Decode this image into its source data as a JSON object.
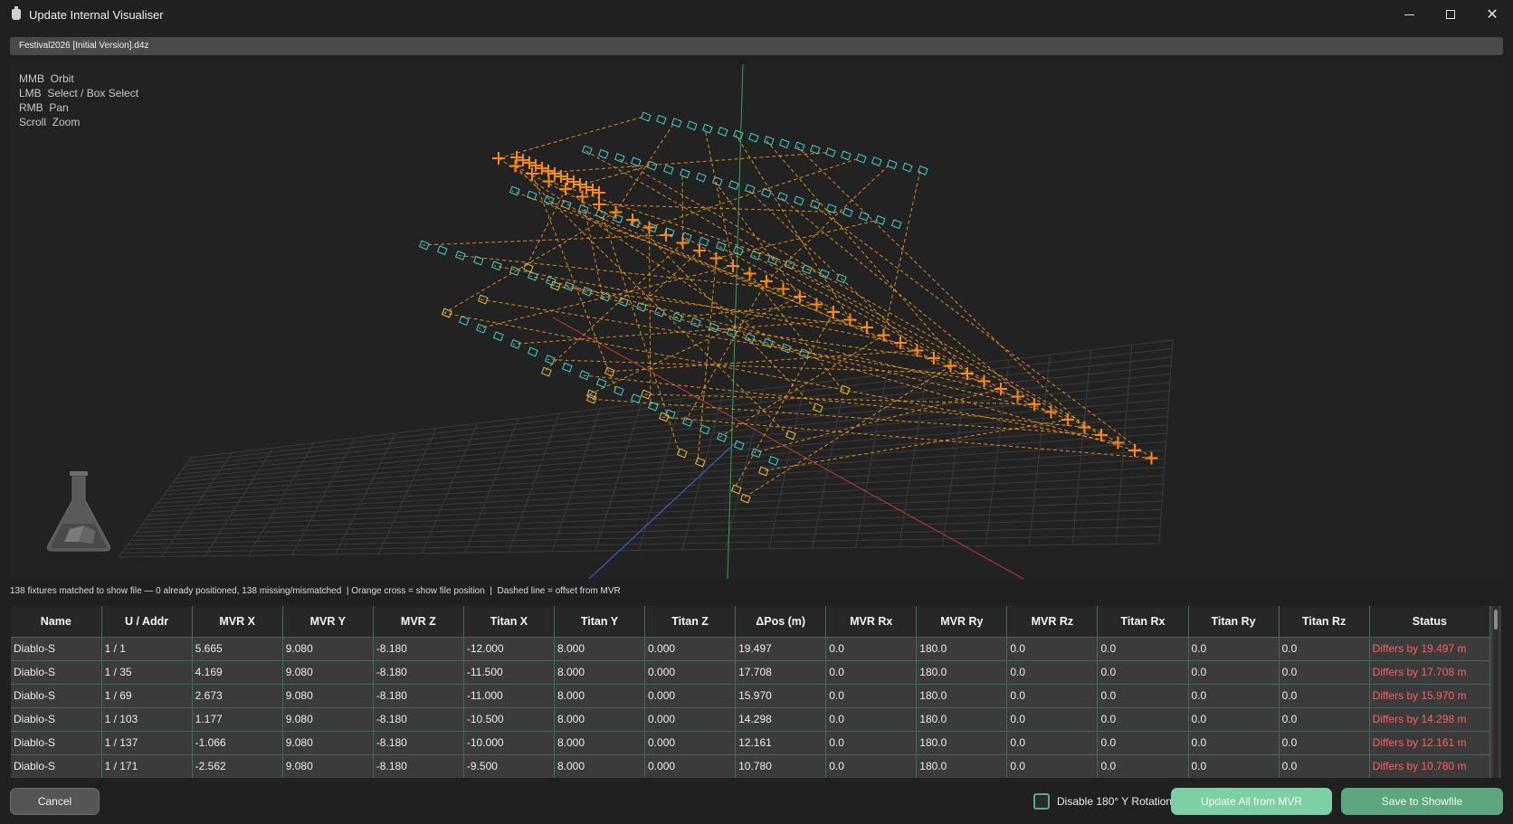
{
  "window": {
    "title": "Update Internal Visualiser",
    "minimize_label": "minimize",
    "maximize_label": "maximize",
    "close_label": "✕"
  },
  "file": {
    "name": "Festival2026 [Initial Version].d4z"
  },
  "viewport": {
    "help": [
      "MMB  Orbit",
      "LMB  Select / Box Select",
      "RMB  Pan",
      "Scroll  Zoom"
    ],
    "colors": {
      "grid": "#3a3a3a",
      "axis_x": "#c03a3a",
      "axis_y": "#3aa04a",
      "axis_z": "#3a6ec8",
      "fixture": "#3fd0d0",
      "fixture_mismatch": "#e0c040",
      "cross": "#ff8a1a",
      "dashed": "#f0961e"
    },
    "logo_icon": "flask-icon"
  },
  "status_line": "138 fixtures matched to show file — 0 already positioned, 138 missing/mismatched  | Orange cross = show file position  |  Dashed line = offset from MVR",
  "table": {
    "columns": [
      "Name",
      "U / Addr",
      "MVR X",
      "MVR Y",
      "MVR Z",
      "Titan X",
      "Titan Y",
      "Titan Z",
      "ΔPos (m)",
      "MVR Rx",
      "MVR Ry",
      "MVR Rz",
      "Titan Rx",
      "Titan Ry",
      "Titan Rz",
      "Status"
    ],
    "rows": [
      [
        "Diablo-S",
        "1 / 1",
        "5.665",
        "9.080",
        "-8.180",
        "-12.000",
        "8.000",
        "0.000",
        "19.497",
        "0.0",
        "180.0",
        "0.0",
        "0.0",
        "0.0",
        "0.0",
        "Differs by 19.497 m"
      ],
      [
        "Diablo-S",
        "1 / 35",
        "4.169",
        "9.080",
        "-8.180",
        "-11.500",
        "8.000",
        "0.000",
        "17.708",
        "0.0",
        "180.0",
        "0.0",
        "0.0",
        "0.0",
        "0.0",
        "Differs by 17.708 m"
      ],
      [
        "Diablo-S",
        "1 / 69",
        "2.673",
        "9.080",
        "-8.180",
        "-11.000",
        "8.000",
        "0.000",
        "15.970",
        "0.0",
        "180.0",
        "0.0",
        "0.0",
        "0.0",
        "0.0",
        "Differs by 15.970 m"
      ],
      [
        "Diablo-S",
        "1 / 103",
        "1.177",
        "9.080",
        "-8.180",
        "-10.500",
        "8.000",
        "0.000",
        "14.298",
        "0.0",
        "180.0",
        "0.0",
        "0.0",
        "0.0",
        "0.0",
        "Differs by 14.298 m"
      ],
      [
        "Diablo-S",
        "1 / 137",
        "-1.066",
        "9.080",
        "-8.180",
        "-10.000",
        "8.000",
        "0.000",
        "12.161",
        "0.0",
        "180.0",
        "0.0",
        "0.0",
        "0.0",
        "0.0",
        "Differs by 12.161 m"
      ],
      [
        "Diablo-S",
        "1 / 171",
        "-2.562",
        "9.080",
        "-8.180",
        "-9.500",
        "8.000",
        "0.000",
        "10.780",
        "0.0",
        "180.0",
        "0.0",
        "0.0",
        "0.0",
        "0.0",
        "Differs by 10.780 m"
      ]
    ],
    "status_color": "#ff5f5f"
  },
  "footer": {
    "cancel_label": "Cancel",
    "checkbox_label": "Disable 180° Y Rotation",
    "checkbox_checked": false,
    "update_label": "Update All from MVR",
    "save_label": "Save to Showfile"
  }
}
